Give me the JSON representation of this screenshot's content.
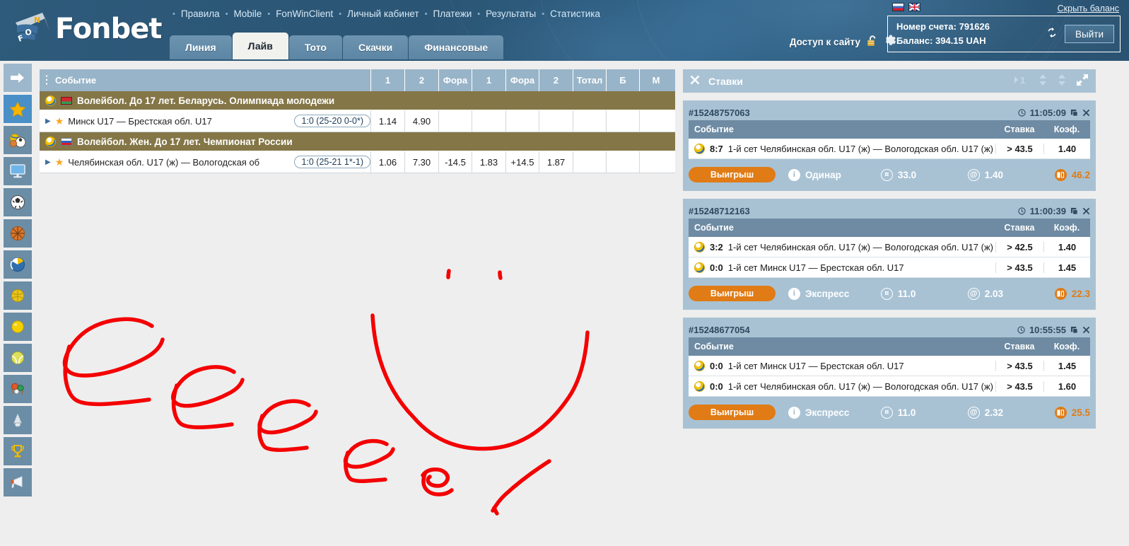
{
  "header": {
    "logo_text": "Fonbet",
    "topnav": [
      "Правила",
      "Mobile",
      "FonWinClient",
      "Личный кабинет",
      "Платежи",
      "Результаты",
      "Статистика"
    ],
    "tabs": [
      {
        "label": "Линия",
        "active": false
      },
      {
        "label": "Лайв",
        "active": true
      },
      {
        "label": "Тото",
        "active": false
      },
      {
        "label": "Скачки",
        "active": false
      },
      {
        "label": "Финансовые",
        "active": false
      }
    ],
    "site_access_label": "Доступ к сайту",
    "lock_icon": "unlock-icon",
    "gear_icon": "gear-icon",
    "flags": [
      "ru-flag",
      "en-flag"
    ],
    "hide_balance": "Скрыть баланс",
    "account_number_line": "Номер счета: 791626",
    "balance_line": "Баланс: 394.15 UAH",
    "refresh_icon": "refresh-icon",
    "logout_label": "Выйти",
    "accent_color": "#2b5574"
  },
  "rail": [
    {
      "name": "collapse-arrow",
      "glyph": "➤",
      "kind": "arrow"
    },
    {
      "name": "favorites",
      "glyph": "★",
      "kind": "star"
    },
    {
      "name": "all-sports",
      "glyph": "⚽",
      "kind": "sport"
    },
    {
      "name": "tv-broadcast",
      "glyph": "🖥",
      "kind": "sport"
    },
    {
      "name": "football",
      "glyph": "⚽",
      "kind": "sport"
    },
    {
      "name": "basketball",
      "glyph": "🏀",
      "kind": "sport"
    },
    {
      "name": "volleyball",
      "glyph": "🏐",
      "kind": "sport"
    },
    {
      "name": "handball",
      "glyph": "🟡",
      "kind": "sport"
    },
    {
      "name": "billiards",
      "glyph": "🟡",
      "kind": "sport"
    },
    {
      "name": "tennis",
      "glyph": "🎾",
      "kind": "sport"
    },
    {
      "name": "table-tennis",
      "glyph": "🏓",
      "kind": "sport"
    },
    {
      "name": "badminton",
      "glyph": "🏸",
      "kind": "sport"
    },
    {
      "name": "trophy",
      "glyph": "🏆",
      "kind": "sport"
    },
    {
      "name": "announcements",
      "glyph": "📢",
      "kind": "sport"
    }
  ],
  "events": {
    "columns": [
      "Событие",
      "1",
      "2",
      "Фора",
      "1",
      "Фора",
      "2",
      "Тотал",
      "Б",
      "М"
    ],
    "groups": [
      {
        "league": "Волейбол. До 17 лет. Беларусь. Олимпиада молодежи",
        "sport_icon": "volleyball-icon",
        "flag": "by-flag",
        "rows": [
          {
            "name": "Минск U17 — Брестская обл. U17",
            "score": "1:0 (25-20 0-0*)",
            "cells": [
              "1.14",
              "4.90",
              "",
              "",
              "",
              "",
              "",
              "",
              ""
            ]
          }
        ]
      },
      {
        "league": "Волейбол. Жен. До 17 лет. Чемпионат России",
        "sport_icon": "volleyball-icon",
        "flag": "ru-flag",
        "rows": [
          {
            "name": "Челябинская обл. U17 (ж) — Вологодская об",
            "score": "1:0 (25-21 1*-1)",
            "cells": [
              "1.06",
              "7.30",
              "-14.5",
              "1.83",
              "+14.5",
              "1.87",
              "",
              "",
              ""
            ]
          }
        ]
      }
    ]
  },
  "slip": {
    "title": "Ставки",
    "close_icon": "close-icon",
    "controls": [
      "▶1",
      "scroll-up-down-1",
      "scroll-up-down-2",
      "expand-icon"
    ],
    "page_indicator": "1",
    "table_headers": {
      "event": "Событие",
      "stake": "Ставка",
      "odds": "Коэф."
    },
    "cards": [
      {
        "id": "#15248757063",
        "time": "11:05:09",
        "clock_icon": "clock-icon",
        "copy_icon": "copy-icon",
        "close_icon": "close-icon",
        "bets": [
          {
            "score": "8:7",
            "sport_icon": "volleyball-icon",
            "event": "1-й сет Челябинская обл. U17 (ж) — Вологодская обл. U17 (ж)",
            "stake": "> 43.5",
            "odds": "1.40"
          }
        ],
        "status": "Выигрыш",
        "type": "Одинар",
        "amount": "33.0",
        "total_odds": "1.40",
        "payout": "46.2"
      },
      {
        "id": "#15248712163",
        "time": "11:00:39",
        "clock_icon": "clock-icon",
        "copy_icon": "copy-icon",
        "close_icon": "close-icon",
        "bets": [
          {
            "score": "3:2",
            "sport_icon": "volleyball-icon",
            "event": "1-й сет Челябинская обл. U17 (ж) — Вологодская обл. U17 (ж)",
            "stake": "> 42.5",
            "odds": "1.40"
          },
          {
            "score": "0:0",
            "sport_icon": "volleyball-icon",
            "event": "1-й сет Минск U17 — Брестская обл. U17",
            "stake": "> 43.5",
            "odds": "1.45"
          }
        ],
        "status": "Выигрыш",
        "type": "Экспресс",
        "amount": "11.0",
        "total_odds": "2.03",
        "payout": "22.3"
      },
      {
        "id": "#15248677054",
        "time": "10:55:55",
        "clock_icon": "clock-icon",
        "copy_icon": "copy-icon",
        "close_icon": "close-icon",
        "bets": [
          {
            "score": "0:0",
            "sport_icon": "volleyball-icon",
            "event": "1-й сет Минск U17 — Брестская обл. U17",
            "stake": "> 43.5",
            "odds": "1.45"
          },
          {
            "score": "0:0",
            "sport_icon": "volleyball-icon",
            "event": "1-й сет Челябинская обл. U17 (ж) — Вологодская обл. U17 (ж)",
            "stake": "> 43.5",
            "odds": "1.60"
          }
        ],
        "status": "Выигрыш",
        "type": "Экспресс",
        "amount": "11.0",
        "total_odds": "2.32",
        "payout": "25.5"
      }
    ]
  },
  "annotation": {
    "color": "#f40000",
    "description": "hand-drawn red scribble of cursive e shapes and a smile curve"
  }
}
